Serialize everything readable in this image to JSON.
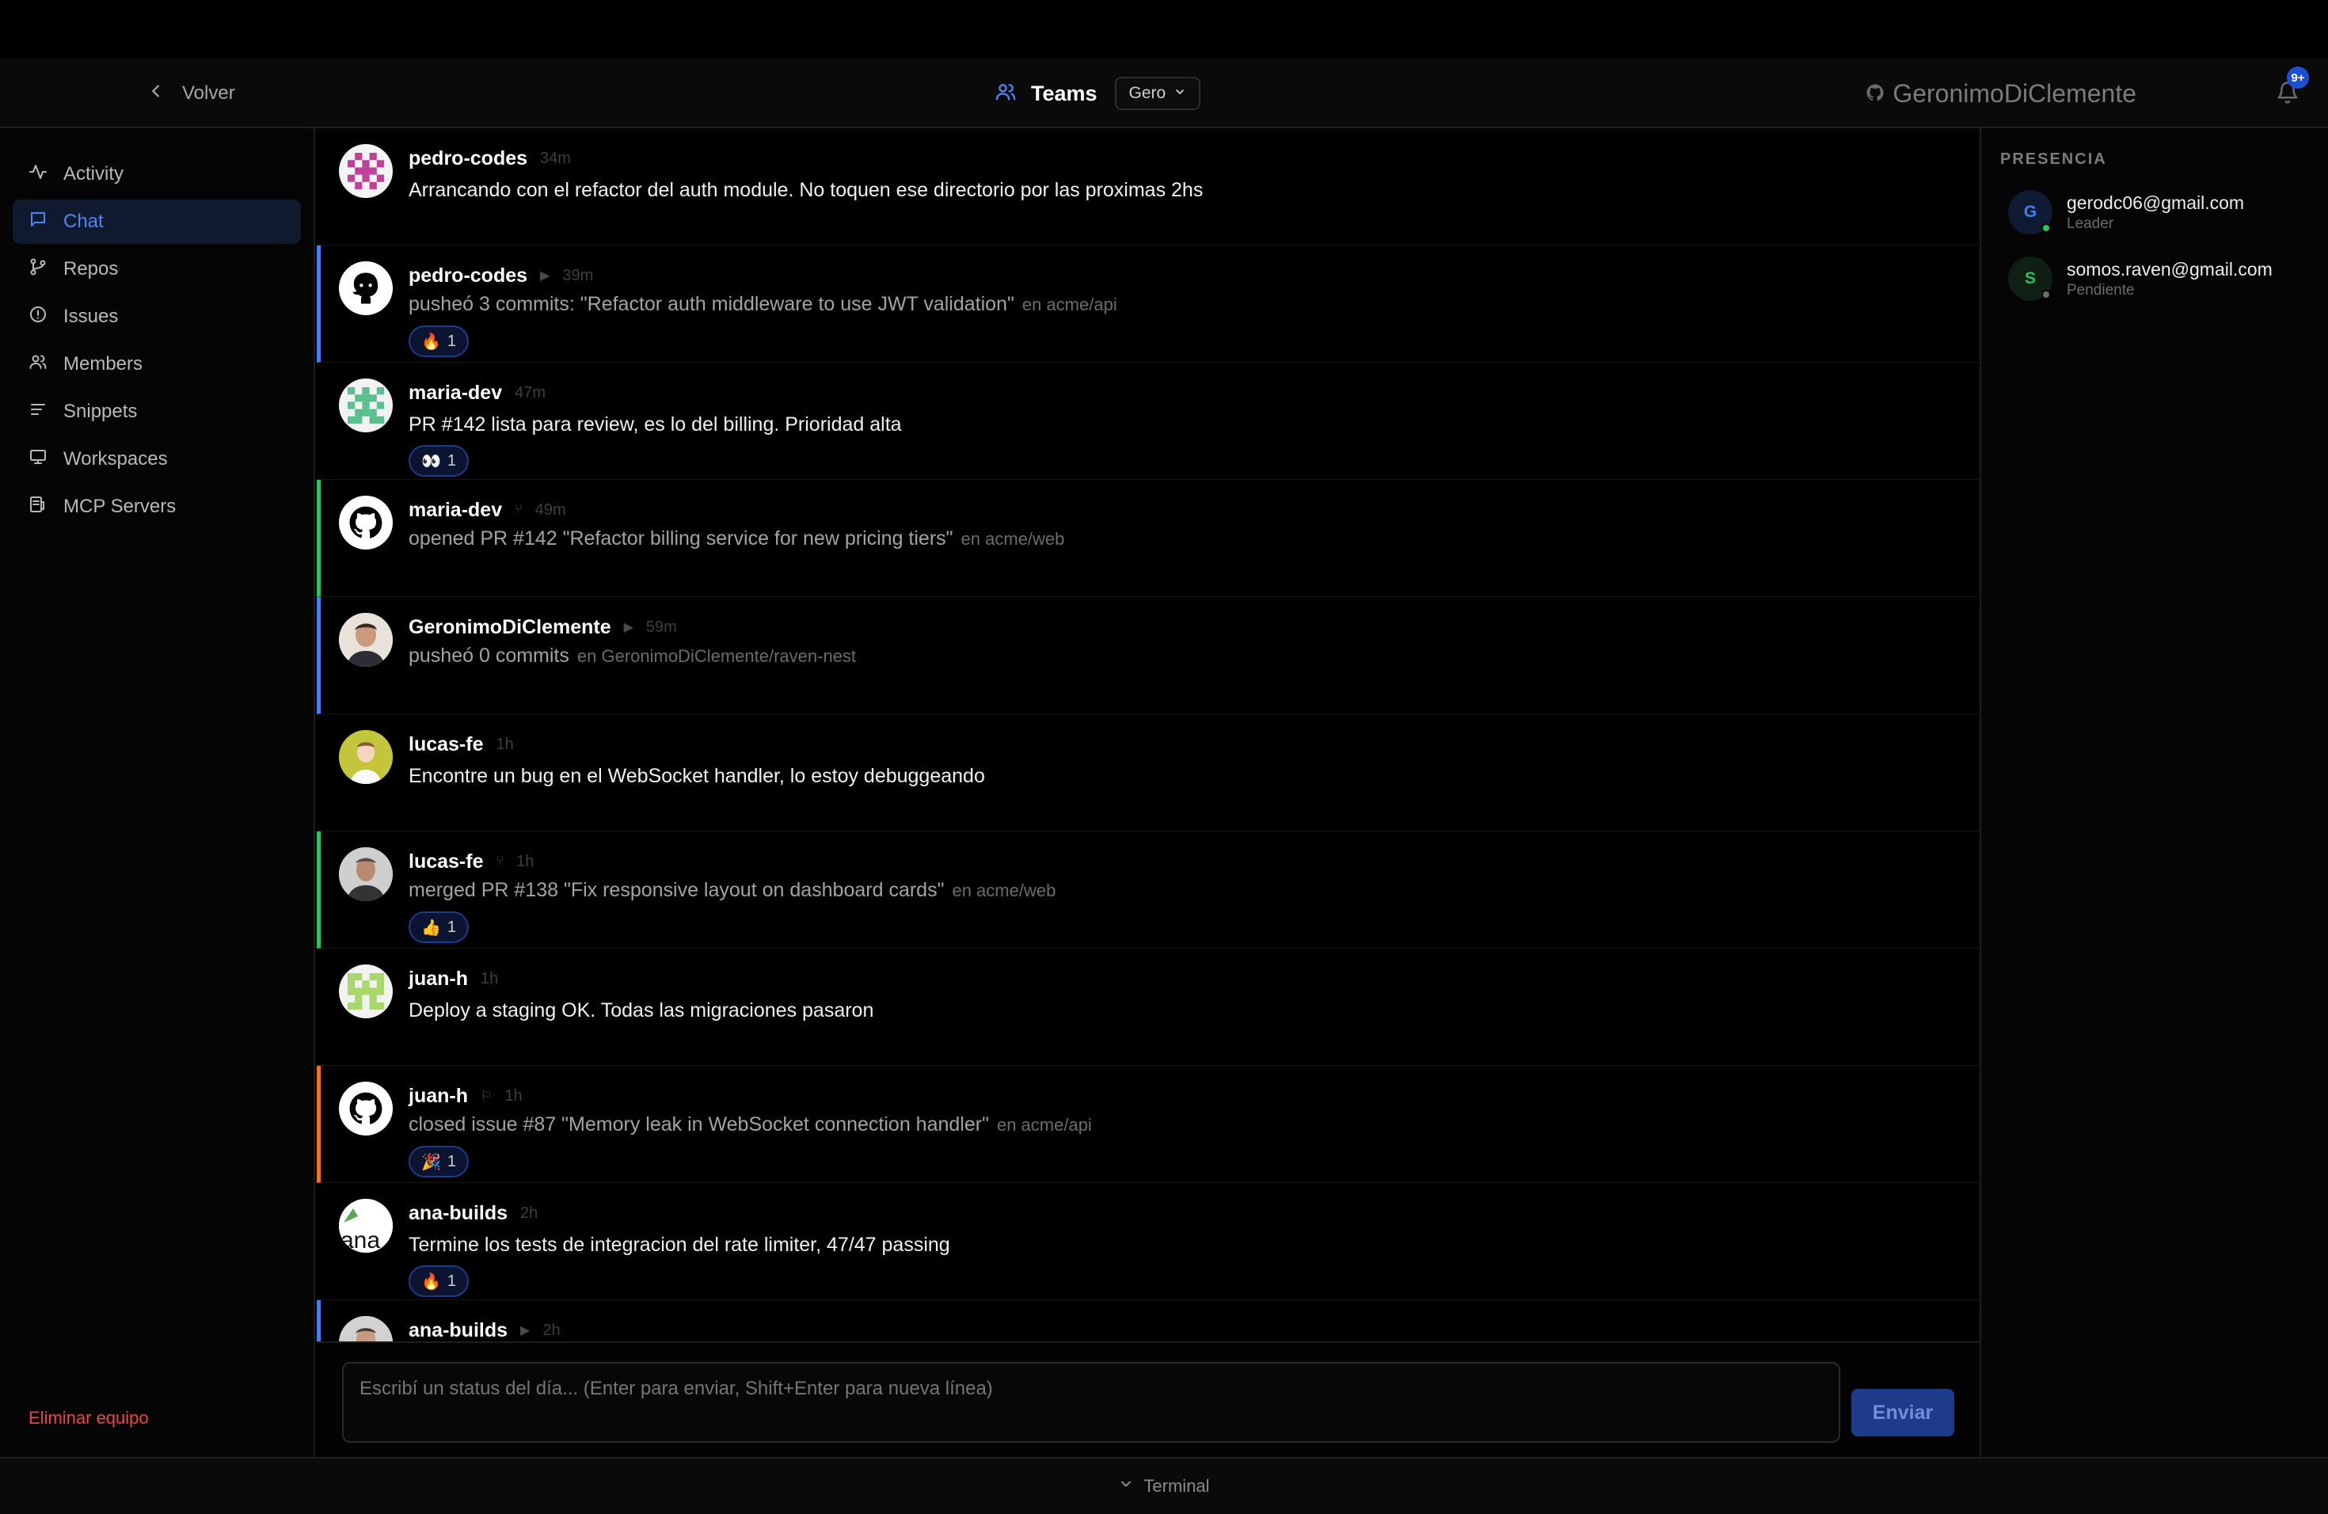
{
  "header": {
    "back_label": "Volver",
    "title": "Teams",
    "team_select": "Gero",
    "user": "GeronimoDiClemente",
    "notifications_badge": "9+"
  },
  "sidebar": {
    "items": [
      {
        "label": "Activity",
        "icon": "activity-icon"
      },
      {
        "label": "Chat",
        "icon": "chat-icon",
        "active": true
      },
      {
        "label": "Repos",
        "icon": "git-branch-icon"
      },
      {
        "label": "Issues",
        "icon": "issue-icon"
      },
      {
        "label": "Members",
        "icon": "members-icon"
      },
      {
        "label": "Snippets",
        "icon": "snippets-icon"
      },
      {
        "label": "Workspaces",
        "icon": "monitor-icon"
      },
      {
        "label": "MCP Servers",
        "icon": "server-icon"
      }
    ],
    "delete_label": "Eliminar equipo"
  },
  "feed": [
    {
      "kind": "message",
      "author": "pedro-codes",
      "time": "34m",
      "text": "Arrancando con el refactor del auth module. No toquen ese directorio por las proximas 2hs",
      "avatar": "identicon-magenta"
    },
    {
      "kind": "event",
      "author": "pedro-codes",
      "time": "39m",
      "event_icon": "▶",
      "accent": "#3b82f6",
      "text": "pusheó 3 commits: \"Refactor auth middleware to use JWT validation\"",
      "repo": "en acme/api",
      "reaction": {
        "emoji": "🔥",
        "count": "1"
      },
      "avatar": "github-octocat"
    },
    {
      "kind": "message",
      "author": "maria-dev",
      "time": "47m",
      "text": "PR #142 lista para review, es lo del billing. Prioridad alta",
      "reaction": {
        "emoji": "👀",
        "count": "1"
      },
      "avatar": "identicon-green"
    },
    {
      "kind": "event",
      "author": "maria-dev",
      "time": "49m",
      "event_icon": "⑂",
      "accent": "#22c55e",
      "text": "opened PR #142 \"Refactor billing service for new pricing tiers\"",
      "repo": "en acme/web",
      "avatar": "github-mark"
    },
    {
      "kind": "event",
      "author": "GeronimoDiClemente",
      "time": "59m",
      "event_icon": "▶",
      "accent": "#3b82f6",
      "text": "pusheó 0 commits",
      "repo": "en GeronimoDiClemente/raven-nest",
      "avatar": "photo-person"
    },
    {
      "kind": "message",
      "author": "lucas-fe",
      "time": "1h",
      "text": "Encontre un bug en el WebSocket handler, lo estoy debuggeando",
      "avatar": "cartoon-person"
    },
    {
      "kind": "event",
      "author": "lucas-fe",
      "time": "1h",
      "event_icon": "⑂",
      "accent": "#22c55e",
      "text": "merged PR #138 \"Fix responsive layout on dashboard cards\"",
      "repo": "en acme/web",
      "reaction": {
        "emoji": "👍",
        "count": "1"
      },
      "avatar": "photo-person-2"
    },
    {
      "kind": "message",
      "author": "juan-h",
      "time": "1h",
      "text": "Deploy a staging OK. Todas las migraciones pasaron",
      "avatar": "identicon-lime"
    },
    {
      "kind": "event",
      "author": "juan-h",
      "time": "1h",
      "event_icon": "⚐",
      "accent": "#f97316",
      "text": "closed issue #87 \"Memory leak in WebSocket connection handler\"",
      "repo": "en acme/api",
      "reaction": {
        "emoji": "🎉",
        "count": "1"
      },
      "avatar": "github-mark"
    },
    {
      "kind": "message",
      "author": "ana-builds",
      "time": "2h",
      "text": "Termine los tests de integracion del rate limiter, 47/47 passing",
      "reaction": {
        "emoji": "🔥",
        "count": "1"
      },
      "avatar": "broken-image"
    },
    {
      "kind": "event",
      "author": "ana-builds",
      "time": "2h",
      "event_icon": "▶",
      "accent": "#3b82f6",
      "text": "",
      "repo": "",
      "avatar": "photo-person-3"
    }
  ],
  "composer": {
    "placeholder": "Escribí un status del día... (Enter para enviar, Shift+Enter para nueva línea)",
    "send_label": "Enviar"
  },
  "presence": {
    "title": "PRESENCIA",
    "members": [
      {
        "initial": "G",
        "email": "gerodc06@gmail.com",
        "role": "Leader",
        "color": "#3b82f6",
        "bg": "#0f1a33",
        "status": "#22c55e"
      },
      {
        "initial": "S",
        "email": "somos.raven@gmail.com",
        "role": "Pendiente",
        "color": "#22c55e",
        "bg": "#0f1f14",
        "status": "#6b6b6b"
      }
    ]
  },
  "footer": {
    "label": "Terminal"
  }
}
